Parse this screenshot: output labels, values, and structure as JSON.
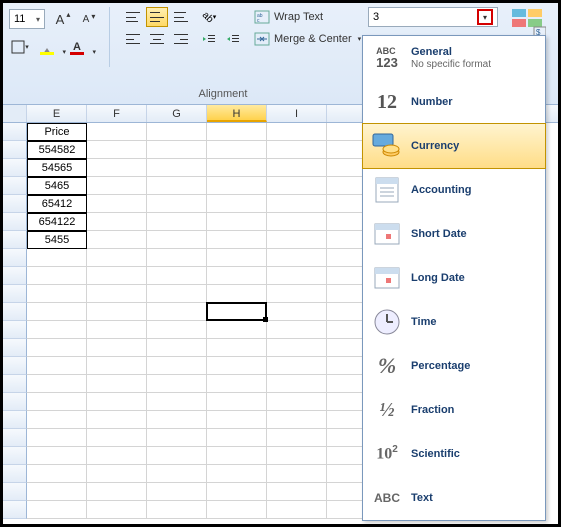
{
  "ribbon": {
    "font_size": "11",
    "wrap_text": "Wrap Text",
    "merge_center": "Merge & Center",
    "alignment_label": "Alignment",
    "fill_color": "#ffff00",
    "font_color": "#d40000",
    "number_box_value": "3"
  },
  "format_dropdown": {
    "items": [
      {
        "label": "General",
        "sub": "No specific format",
        "icon": "abc123"
      },
      {
        "label": "Number",
        "sub": "",
        "icon": "twelve"
      },
      {
        "label": "Currency",
        "sub": "",
        "icon": "coins",
        "selected": true
      },
      {
        "label": "Accounting",
        "sub": "",
        "icon": "ledger"
      },
      {
        "label": "Short Date",
        "sub": "",
        "icon": "calendar"
      },
      {
        "label": "Long Date",
        "sub": "",
        "icon": "calendar"
      },
      {
        "label": "Time",
        "sub": "",
        "icon": "clock"
      },
      {
        "label": "Percentage",
        "sub": "",
        "icon": "percent"
      },
      {
        "label": "Fraction",
        "sub": "",
        "icon": "fraction"
      },
      {
        "label": "Scientific",
        "sub": "",
        "icon": "scientific"
      },
      {
        "label": "Text",
        "sub": "",
        "icon": "abc"
      }
    ]
  },
  "sheet": {
    "columns": [
      "E",
      "F",
      "G",
      "H",
      "I"
    ],
    "selected_column": "H",
    "data": [
      "Price",
      "554582",
      "54565",
      "5465",
      "65412",
      "654122",
      "5455"
    ],
    "active_cell": {
      "col": "H",
      "row": 11
    }
  }
}
